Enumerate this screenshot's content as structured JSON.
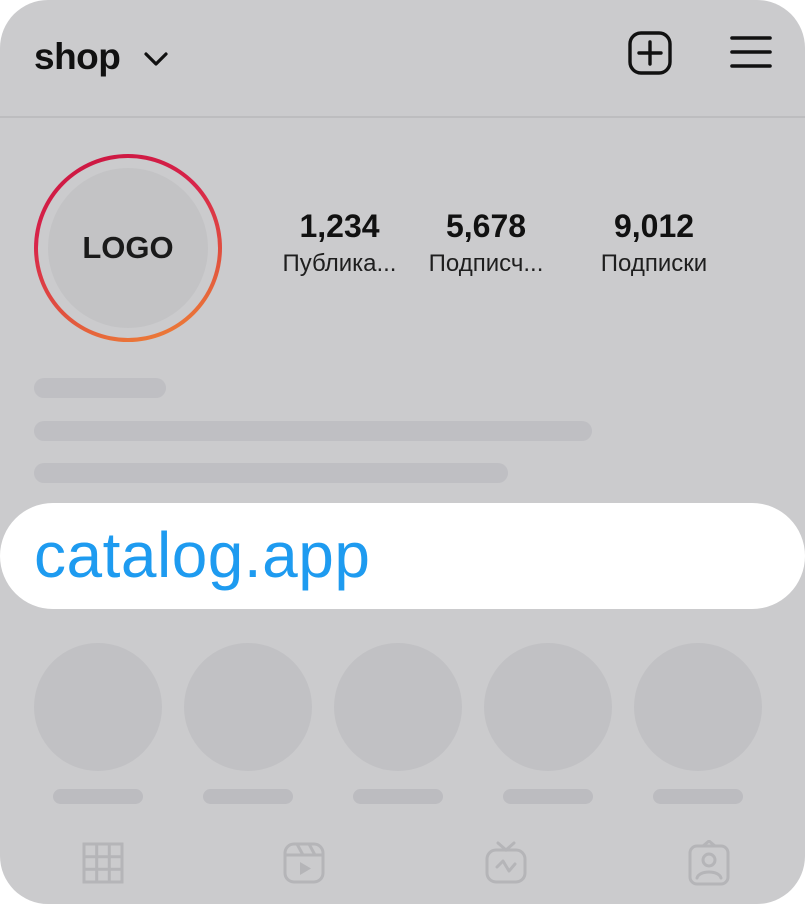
{
  "header": {
    "username": "shop",
    "icons": [
      "chevron-down-icon",
      "add-post-icon",
      "menu-icon"
    ]
  },
  "profile": {
    "avatar_text": "LOGO",
    "stats": [
      {
        "value": "1,234",
        "label": "Публика..."
      },
      {
        "value": "5,678",
        "label": "Подписч..."
      },
      {
        "value": "9,012",
        "label": "Подписки"
      }
    ]
  },
  "link": {
    "text": "catalog.app",
    "color": "#1e9bf0"
  },
  "highlights_count": 5,
  "tabs": [
    "grid-icon",
    "reels-icon",
    "igtv-icon",
    "tagged-icon"
  ],
  "colors": {
    "background": "#cbcbcd",
    "avatar_ring_start": "#c9123f",
    "avatar_ring_end": "#f08a35"
  }
}
